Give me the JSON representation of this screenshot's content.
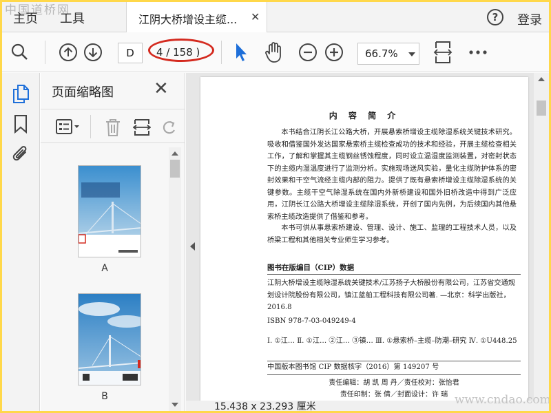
{
  "watermark_top": "中国道桥网",
  "menu": {
    "home": "主页",
    "tools": "工具"
  },
  "tab": {
    "title": "江阴大桥增设主缆...",
    "close_glyph": "✕"
  },
  "header_right": {
    "help_glyph": "?",
    "login": "登录"
  },
  "toolbar": {
    "page_input": "D",
    "page_count": "4 / 158 )",
    "zoom": "66.7%",
    "icons": [
      "search-icon",
      "arrow-up-icon",
      "arrow-down-icon",
      "select-arrow-icon",
      "hand-icon",
      "zoom-out-icon",
      "zoom-in-icon",
      "fit-page-icon",
      "more-icon"
    ]
  },
  "rail": {
    "icons": [
      "pages-icon",
      "bookmark-icon",
      "attachment-icon"
    ]
  },
  "panel": {
    "title": "页面缩略图",
    "close_glyph": "✕",
    "tool_icons": [
      "thumbnail-options-icon",
      "delete-icon",
      "extract-icon",
      "rotate-icon"
    ],
    "thumbnails": [
      {
        "label": "A",
        "cover_title": "江阴大桥增设主缆除湿系统关键技术"
      },
      {
        "label": "B"
      }
    ]
  },
  "document": {
    "intro_title": "内 容 简 介",
    "paragraphs": [
      "本书结合江阴长江公路大桥，开展悬索桥增设主缆除湿系统关键技术研究。吸收和借鉴国外发达国家悬索桥主缆检查成功的技术和经验，开展主缆检查相关工作，了解和掌握其主缆钢丝锈蚀程度，同时设立温湿度监测装置，对密封状态下的主缆内湿温度进行了监测分析。实施现场送风实验，量化主缆防护体系的密封效果和干空气流经主缆内部的阻力。提供了既有悬索桥增设主缆除湿系统的关键参数。主缆干空气除湿系统在国内外新桥建设和国外旧桥改造中得到广泛应用，江阴长江公路大桥增设主缆除湿系统，开创了国内先例，为后续国内其他悬索桥主缆改造提供了借鉴和参考。",
      "本书可供从事悬索桥建设、管理、设计、施工、监理的工程技术人员，以及桥梁工程和其他相关专业师生学习参考。"
    ],
    "cip_heading": "图书在版编目（CIP）数据",
    "cip_entry": "江阴大桥增设主缆除湿系统关键技术/江苏扬子大桥股份有限公司，江苏省交通规划设计院股份有限公司，镇江蓝舶工程科技有限公司著. —北京：科学出版社，2016.8",
    "isbn": "ISBN  978-7-03-049249-4",
    "classification": "Ⅰ. ①江…   Ⅱ. ①江…   ②江…   ③镇…   Ⅲ. ①悬索桥–主缆–防潮–研究   Ⅳ. ①U448.25",
    "cip_number": "中国版本图书馆 CIP 数据核字（2016）第 149207 号",
    "credit_line1": "责任编辑：胡   凯   周   丹／责任校对：张怡君",
    "credit_line2": "责任印制：张   倩／封面设计：许   瑞"
  },
  "status_bar": {
    "size": "15.438 x 23.293 厘米"
  },
  "watermark_bottom": "www.cndao.com",
  "colors": {
    "accent_blue": "#1e6fd9",
    "annotation_red": "#d42a1f",
    "frame_yellow": "#ffd84a"
  }
}
